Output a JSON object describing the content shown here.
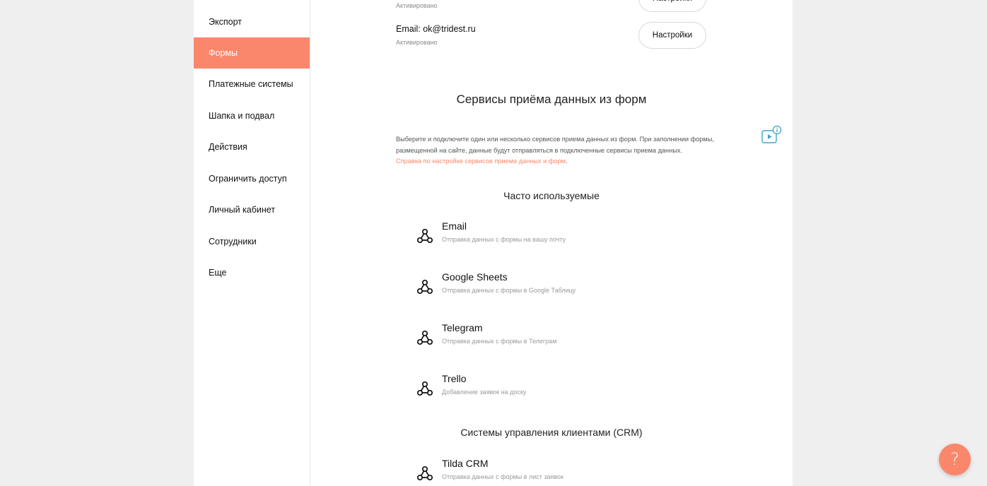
{
  "sidebar": {
    "items": [
      {
        "label": "Экспорт",
        "active": false
      },
      {
        "label": "Формы",
        "active": true
      },
      {
        "label": "Платежные системы",
        "active": false
      },
      {
        "label": "Шапка и подвал",
        "active": false
      },
      {
        "label": "Действия",
        "active": false
      },
      {
        "label": "Ограничить доступ",
        "active": false
      },
      {
        "label": "Личный кабинет",
        "active": false
      },
      {
        "label": "Сотрудники",
        "active": false
      },
      {
        "label": "Еще",
        "active": false
      }
    ]
  },
  "accounts": {
    "first": {
      "status": "Активировано",
      "button": "Настройки"
    },
    "second": {
      "email": "Email: ok@tridest.ru",
      "status": "Активировано",
      "button": "Настройки"
    }
  },
  "services_section": {
    "title": "Сервисы приёма данных из форм",
    "description": "Выберите и подключите один или несколько сервисов приема данных из форм. При заполнении формы, размещенной на сайте, данные будут отправляться в подключенные сервисы приема данных.",
    "help_link": "Справка по настройке сервисов приема данных и форм",
    "help_link_suffix": ".",
    "video_icon": "video-info-icon"
  },
  "groups": {
    "frequent": {
      "title": "Часто используемые",
      "services": [
        {
          "name": "Email",
          "sub": "Отправка данных с формы на вашу почту",
          "icon": "webhook-icon"
        },
        {
          "name": "Google Sheets",
          "sub": "Отправка данных с формы в Google Таблицу",
          "icon": "webhook-icon"
        },
        {
          "name": "Telegram",
          "sub": "Отправка данных с формы в Телеграм",
          "icon": "webhook-icon"
        },
        {
          "name": "Trello",
          "sub": "Добавление заявок на доску",
          "icon": "webhook-icon"
        }
      ]
    },
    "crm": {
      "title": "Системы управления клиентами (CRM)",
      "services": [
        {
          "name": "Tilda CRM",
          "sub": "Отправка данных с формы в лист заявок",
          "icon": "webhook-icon"
        }
      ]
    }
  },
  "help_fab": {
    "label": "?"
  },
  "colors": {
    "accent": "#fa876b",
    "background": "#efeff0",
    "panel": "#ffffff",
    "info_blue": "#3aa6c7"
  }
}
